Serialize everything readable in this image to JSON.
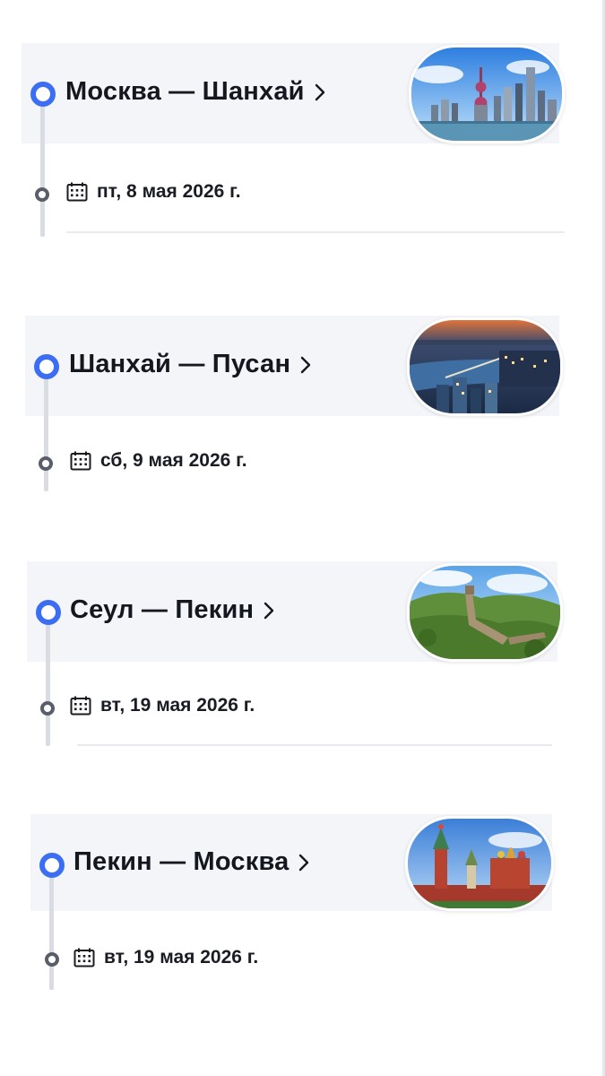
{
  "segments": [
    {
      "route": "Москва — Шанхай",
      "date": "пт, 8 мая 2026 г.",
      "photo": "shanghai-skyline"
    },
    {
      "route": "Шанхай — Пусан",
      "date": "сб, 9 мая 2026 г.",
      "photo": "busan-night"
    },
    {
      "route": "Сеул — Пекин",
      "date": "вт, 19 мая 2026 г.",
      "photo": "great-wall"
    },
    {
      "route": "Пекин — Москва",
      "date": "вт, 19 мая 2026 г.",
      "photo": "moscow-kremlin"
    }
  ],
  "colors": {
    "accent": "#3b6ef3",
    "header_bg": "#f3f5f9",
    "timeline": "#d9dce3",
    "text": "#15171f"
  }
}
